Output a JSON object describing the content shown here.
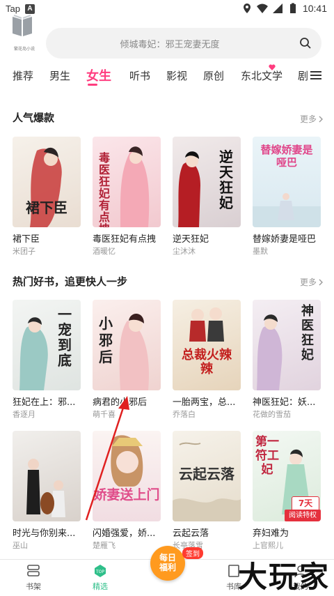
{
  "status_bar": {
    "left_text": "Tap",
    "left_badge": "A",
    "time": "10:41"
  },
  "app": {
    "logo_text": "繁花岛小说"
  },
  "search": {
    "placeholder": "倾城毒妃：邪王宠妻无度"
  },
  "tabs": [
    {
      "label": "推荐"
    },
    {
      "label": "男生"
    },
    {
      "label": "女生",
      "active": true
    },
    {
      "label": "听书"
    },
    {
      "label": "影视"
    },
    {
      "label": "原创"
    },
    {
      "label": "东北文学"
    },
    {
      "label": "剧"
    }
  ],
  "sections": [
    {
      "title": "人气爆款",
      "more": "更多",
      "books": [
        {
          "title": "裙下臣",
          "author": "米团子",
          "cover_text": "裙下臣",
          "cover_color": "#f3ede6"
        },
        {
          "title": "毒医狂妃有点拽",
          "author": "酒暖忆",
          "cover_text": "毒医狂妃有点拽",
          "cover_color": "#f6d6da"
        },
        {
          "title": "逆天狂妃",
          "author": "尘沐沐",
          "cover_text": "逆天狂妃",
          "cover_color": "#e8e2e4"
        },
        {
          "title": "替嫁娇妻是哑巴",
          "author": "墨默",
          "cover_text": "替嫁娇妻是哑巴",
          "cover_color": "#e6f1f6"
        }
      ]
    },
    {
      "title": "热门好书，追更快人一步",
      "more": "更多",
      "books": [
        {
          "title": "狂妃在上：邪...",
          "author": "香逐月",
          "cover_text": "一宠到底",
          "cover_color": "#eef0ef"
        },
        {
          "title": "病君的小邪后",
          "author": "萌千喜",
          "cover_text": "小邪后",
          "cover_color": "#f7e6e4"
        },
        {
          "title": "一胎两宝，总...",
          "author": "乔落白",
          "cover_text": "总裁火辣辣",
          "cover_color": "#f2e8d8"
        },
        {
          "title": "神医狂妃：妖...",
          "author": "花做的雪茄",
          "cover_text": "神医狂妃",
          "cover_color": "#efe8ee"
        },
        {
          "title": "时光与你别来...",
          "author": "巫山",
          "cover_text": "",
          "cover_color": "#ede9e6"
        },
        {
          "title": "闪婚强爱，娇...",
          "author": "楚雁飞",
          "cover_text": "娇妻送上门",
          "cover_color": "#f6eef0"
        },
        {
          "title": "云起云落",
          "author": "长亭落雪",
          "cover_text": "云起云落",
          "cover_color": "#f1ece1"
        },
        {
          "title": "弃妇难为",
          "author": "上官熙儿",
          "cover_text": "第一符工妃",
          "cover_color": "#eef5ee",
          "badge_top": "7天",
          "badge_bottom": "阅读特权"
        }
      ]
    }
  ],
  "bottom_nav": [
    {
      "label": "书架"
    },
    {
      "label": "精选",
      "active": true
    },
    {
      "label": "书库"
    },
    {
      "label": "我的"
    }
  ],
  "fab": {
    "line1": "每日",
    "line2": "福利",
    "tag": "签到"
  },
  "watermark": "大玩家",
  "colors": {
    "accent": "#ff3d7f",
    "nav_active": "#2fbf8a",
    "fab": "#ff9a1f",
    "arrow": "#e02020"
  }
}
